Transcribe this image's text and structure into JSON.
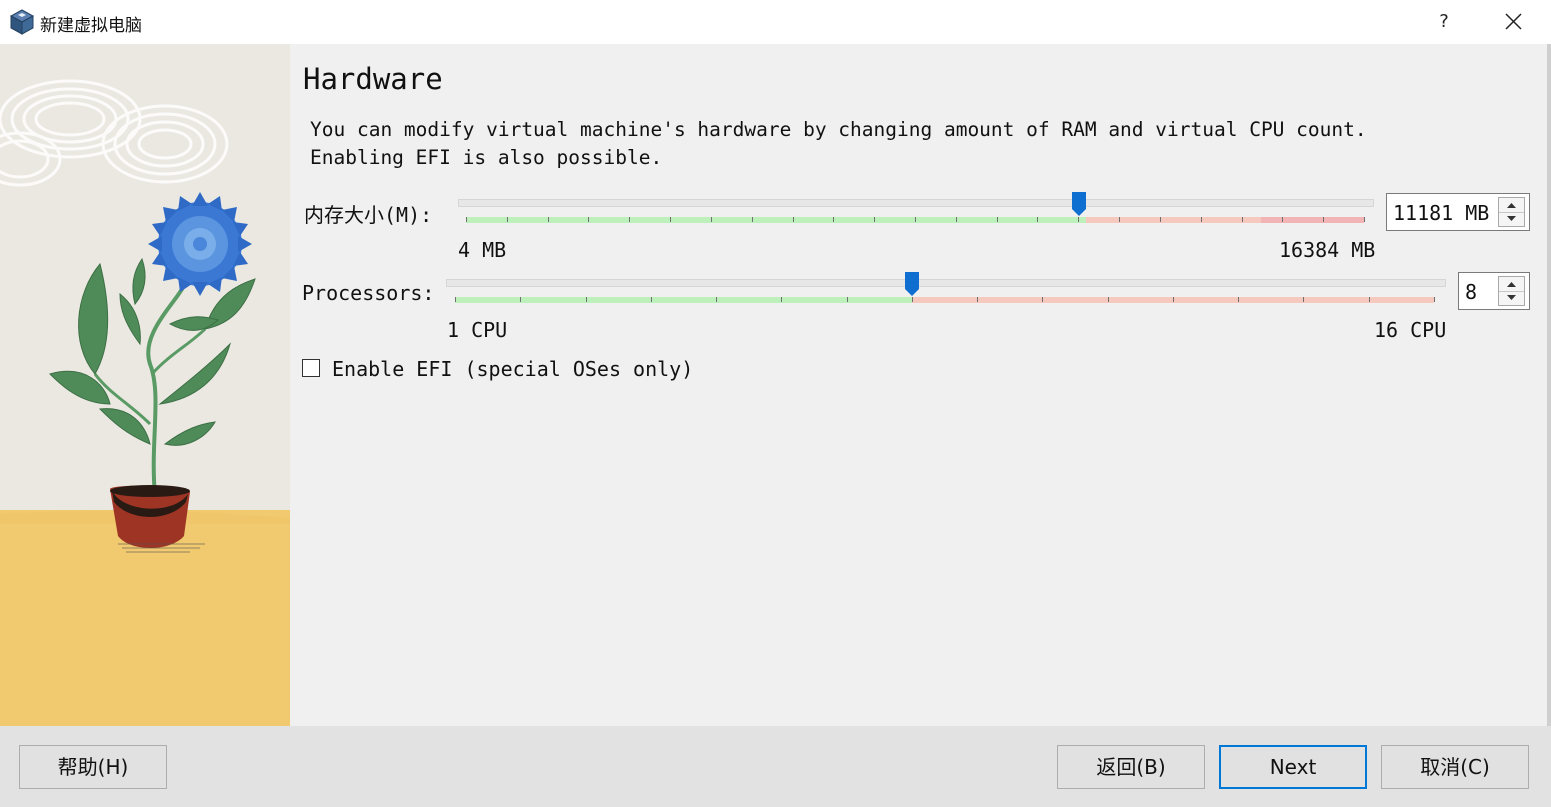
{
  "window": {
    "title": "新建虚拟电脑",
    "help_label": "?",
    "close_label": "close"
  },
  "page": {
    "heading": "Hardware",
    "description": "You can modify virtual machine's hardware by changing amount of RAM and virtual CPU count.\nEnabling EFI is also possible."
  },
  "memory": {
    "label": "内存大小(M):",
    "min_label": "4 MB",
    "max_label": "16384 MB",
    "min": 4,
    "max": 16384,
    "value": 11181,
    "value_text": "11181 MB",
    "recommended_max": 11310,
    "colors": {
      "safe": "#bdf0bb",
      "warn": "#f6c9be",
      "danger": "#f2b4b4",
      "handle": "#0e6fd1"
    }
  },
  "processors": {
    "label": "Processors:",
    "min_label": "1 CPU",
    "max_label": "16 CPU",
    "min": 1,
    "max": 16,
    "value": 8,
    "value_text": "8",
    "recommended_max": 8,
    "colors": {
      "safe": "#bdf0bb",
      "warn": "#f6c9be",
      "handle": "#0e6fd1"
    }
  },
  "efi": {
    "label": "Enable EFI (special OSes only)",
    "checked": false
  },
  "buttons": {
    "help": "帮助(H)",
    "back": "返回(B)",
    "next": "Next",
    "cancel": "取消(C)"
  },
  "icons": {
    "app": "virtualbox-cube-icon",
    "close": "close-icon",
    "spin_up": "chevron-up-icon",
    "spin_down": "chevron-down-icon"
  },
  "illustration": "potted-blue-flower"
}
